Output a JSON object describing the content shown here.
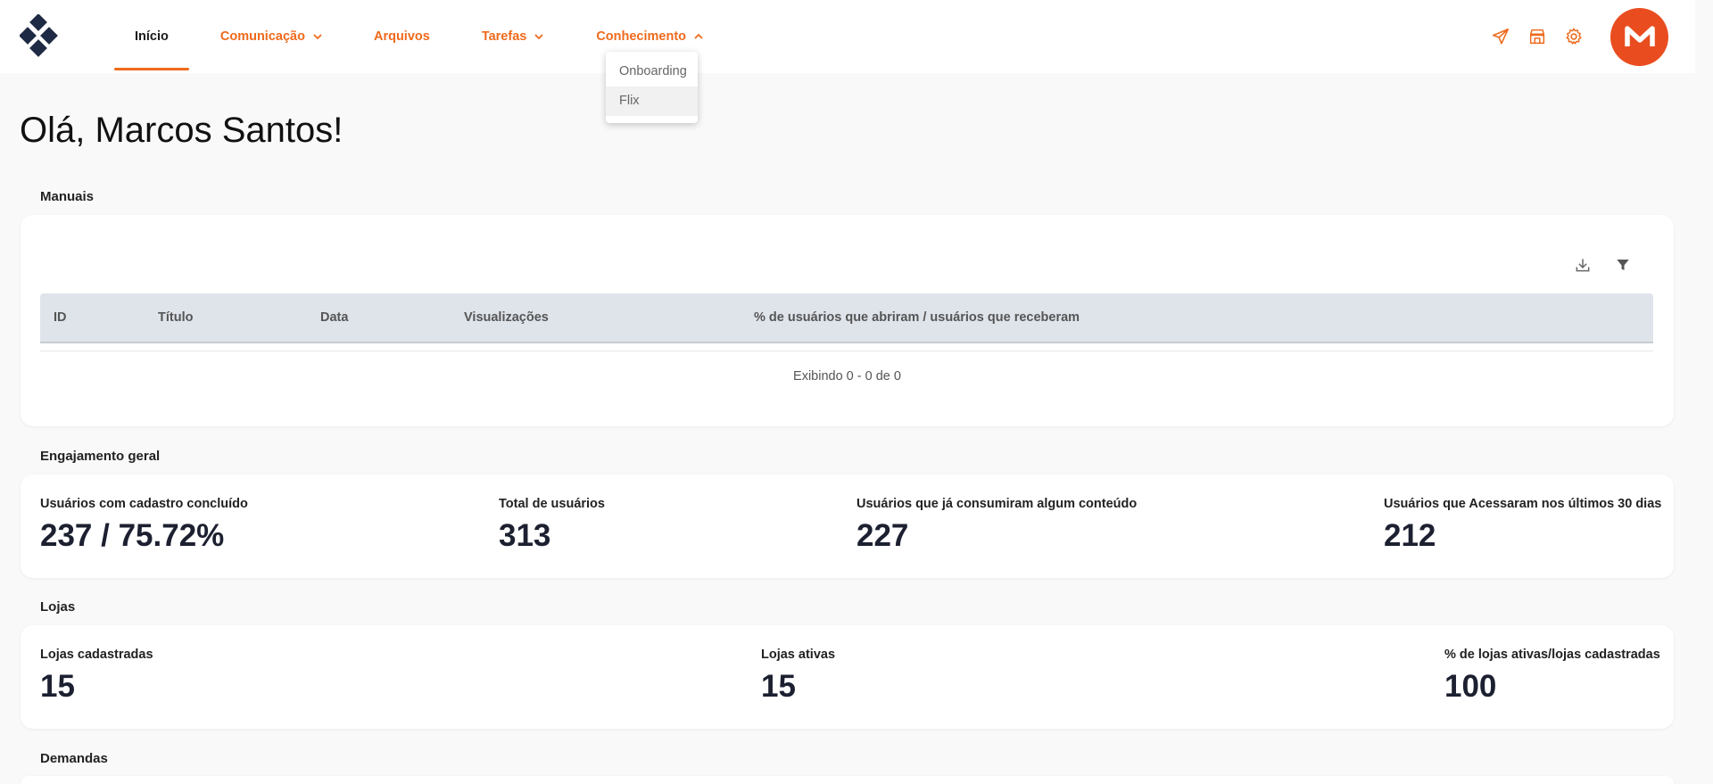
{
  "nav": {
    "items": [
      {
        "label": "Início",
        "active": true,
        "dropdown": null
      },
      {
        "label": "Comunicação",
        "active": false,
        "dropdown": "down"
      },
      {
        "label": "Arquivos",
        "active": false,
        "dropdown": null
      },
      {
        "label": "Tarefas",
        "active": false,
        "dropdown": "down"
      },
      {
        "label": "Conhecimento",
        "active": false,
        "dropdown": "up"
      }
    ],
    "right_icons": [
      "send-icon",
      "store-icon",
      "gear-icon"
    ],
    "avatar_letter": "M",
    "accent_color": "#ee6a1c",
    "avatar_color": "#e94d1f"
  },
  "dropdown": {
    "items": [
      "Onboarding",
      "Flix"
    ]
  },
  "greeting": "Olá, Marcos Santos!",
  "manuals": {
    "title": "Manuais",
    "tools": [
      "download-icon",
      "filter-icon"
    ],
    "columns": [
      "ID",
      "Título",
      "Data",
      "Visualizações",
      "% de usuários que abriram / usuários que receberam"
    ],
    "rows": [],
    "pager": "Exibindo 0 - 0 de 0"
  },
  "engagement": {
    "title": "Engajamento geral",
    "stats": [
      {
        "label": "Usuários com cadastro concluído",
        "value": "237 / 75.72%"
      },
      {
        "label": "Total de usuários",
        "value": "313"
      },
      {
        "label": "Usuários que já consumiram algum conteúdo",
        "value": "227"
      },
      {
        "label": "Usuários que Acessaram nos últimos 30 dias",
        "value": "212"
      }
    ]
  },
  "stores": {
    "title": "Lojas",
    "stats": [
      {
        "label": "Lojas cadastradas",
        "value": "15"
      },
      {
        "label": "Lojas ativas",
        "value": "15"
      },
      {
        "label": "% de lojas ativas/lojas cadastradas",
        "value": "100"
      }
    ]
  },
  "demands": {
    "title": "Demandas"
  }
}
